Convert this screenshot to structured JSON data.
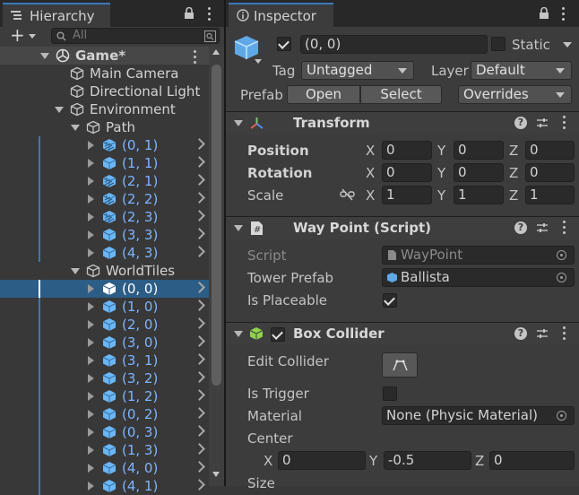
{
  "hierarchy": {
    "tab_label": "Hierarchy",
    "search_placeholder": "All",
    "add_label": "+",
    "scene_name": "Game*",
    "rows": [
      {
        "label": "Main Camera",
        "blue": false
      },
      {
        "label": "Directional Light",
        "blue": false
      },
      {
        "label": "Environment",
        "blue": false
      },
      {
        "label": "Path",
        "blue": false
      },
      {
        "label": "(0, 1)",
        "blue": true
      },
      {
        "label": "(1, 1)",
        "blue": true
      },
      {
        "label": "(2, 1)",
        "blue": true
      },
      {
        "label": "(2, 2)",
        "blue": true
      },
      {
        "label": "(2, 3)",
        "blue": true
      },
      {
        "label": "(3, 3)",
        "blue": true
      },
      {
        "label": "(4, 3)",
        "blue": true
      },
      {
        "label": "WorldTiles",
        "blue": false
      },
      {
        "label": "(0, 0)",
        "blue": true
      },
      {
        "label": "(1, 0)",
        "blue": true
      },
      {
        "label": "(2, 0)",
        "blue": true
      },
      {
        "label": "(3, 0)",
        "blue": true
      },
      {
        "label": "(3, 1)",
        "blue": true
      },
      {
        "label": "(3, 2)",
        "blue": true
      },
      {
        "label": "(1, 2)",
        "blue": true
      },
      {
        "label": "(0, 2)",
        "blue": true
      },
      {
        "label": "(0, 3)",
        "blue": true
      },
      {
        "label": "(1, 3)",
        "blue": true
      },
      {
        "label": "(4, 0)",
        "blue": true
      },
      {
        "label": "(4, 1)",
        "blue": true
      }
    ],
    "selected_row": "(0, 0)"
  },
  "inspector": {
    "tab_label": "Inspector",
    "object_name": "(0, 0)",
    "static_label": "Static",
    "tag_label": "Tag",
    "tag_value": "Untagged",
    "layer_label": "Layer",
    "layer_value": "Default",
    "prefab_label": "Prefab",
    "prefab_open": "Open",
    "prefab_select": "Select",
    "prefab_overrides": "Overrides",
    "transform": {
      "title": "Transform",
      "position_label": "Position",
      "rotation_label": "Rotation",
      "scale_label": "Scale",
      "position": {
        "x": "0",
        "y": "0",
        "z": "0"
      },
      "rotation": {
        "x": "0",
        "y": "0",
        "z": "0"
      },
      "scale": {
        "x": "1",
        "y": "1",
        "z": "1"
      },
      "axis_x": "X",
      "axis_y": "Y",
      "axis_z": "Z"
    },
    "waypoint": {
      "title": "Way Point (Script)",
      "script_label": "Script",
      "script_value": "WayPoint",
      "tower_label": "Tower Prefab",
      "tower_value": "Ballista",
      "placeable_label": "Is Placeable",
      "placeable_checked": true
    },
    "box_collider": {
      "title": "Box Collider",
      "edit_label": "Edit Collider",
      "trigger_label": "Is Trigger",
      "material_label": "Material",
      "material_value": "None (Physic Material)",
      "center_label": "Center",
      "center": {
        "x": "0",
        "y": "-0.5",
        "z": "0"
      },
      "size_label": "Size"
    }
  },
  "colors": {
    "selection": "#2c5d87",
    "prefab_blue": "#7fb4ff",
    "tab_accent": "#3a79bb"
  }
}
